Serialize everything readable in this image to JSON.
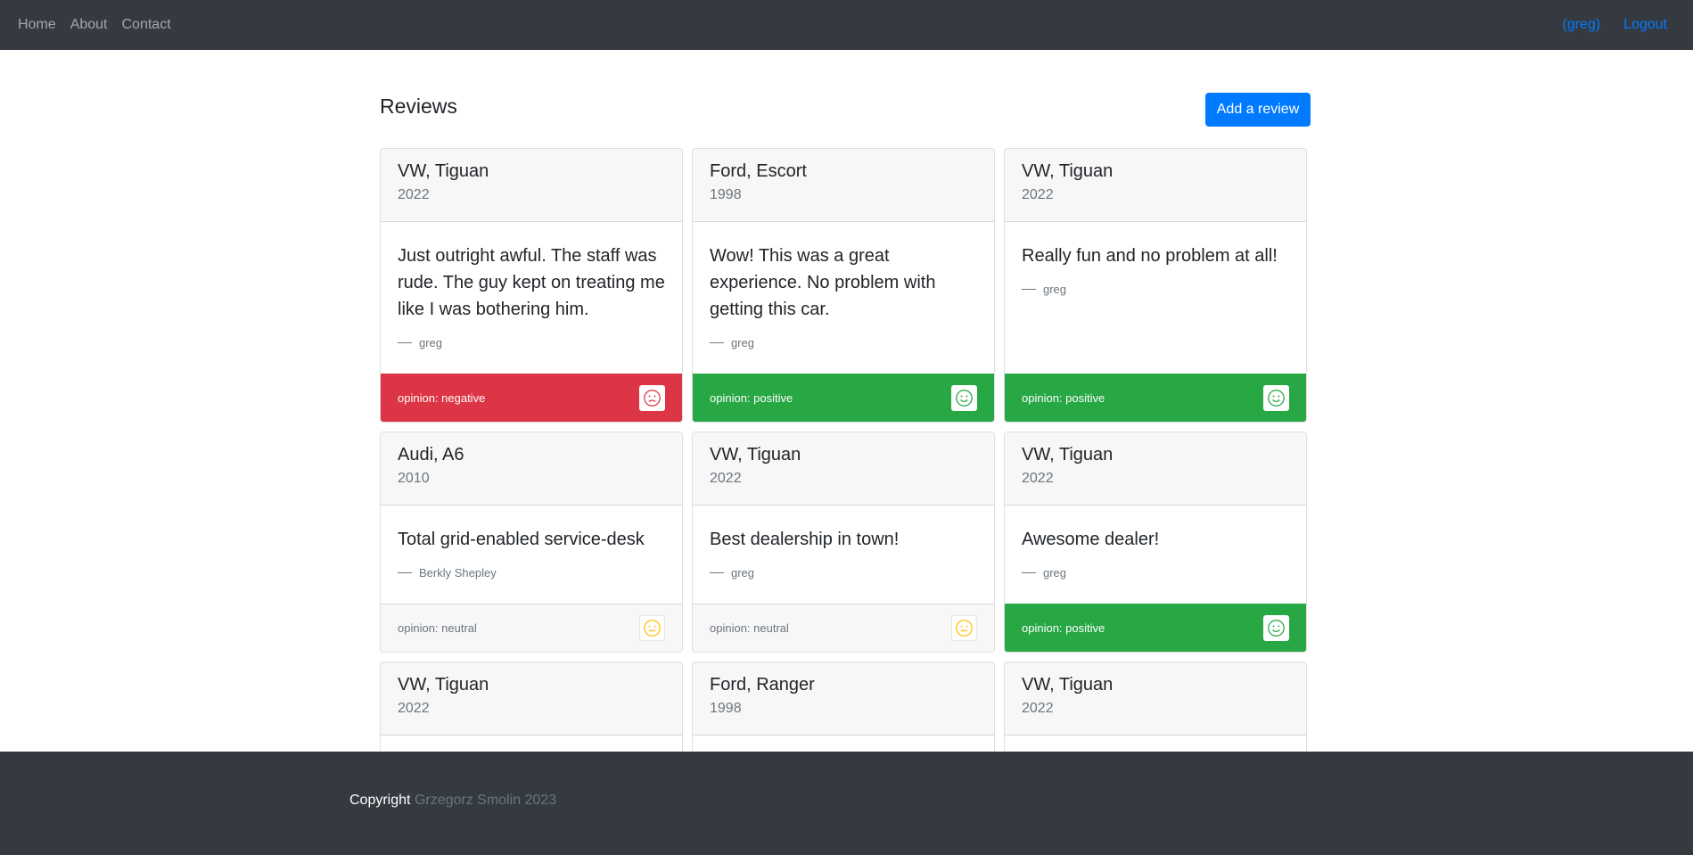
{
  "nav": {
    "links": [
      "Home",
      "About",
      "Contact"
    ],
    "user": "(greg)",
    "logout": "Logout"
  },
  "page": {
    "title": "Reviews",
    "add_button": "Add a review"
  },
  "reviews": [
    {
      "title": "VW, Tiguan",
      "year": "2022",
      "text": "Just outright awful. The staff was rude. The guy kept on treating me like I was bothering him.",
      "author": "greg",
      "opinion": "opinion: negative",
      "sentiment": "negative",
      "icon": "frown-icon"
    },
    {
      "title": "Ford, Escort",
      "year": "1998",
      "text": "Wow! This was a great experience. No problem with getting this car.",
      "author": "greg",
      "opinion": "opinion: positive",
      "sentiment": "positive",
      "icon": "smile-icon"
    },
    {
      "title": "VW, Tiguan",
      "year": "2022",
      "text": "Really fun and no problem at all!",
      "author": "greg",
      "opinion": "opinion: positive",
      "sentiment": "positive",
      "icon": "smile-icon"
    },
    {
      "title": "Audi, A6",
      "year": "2010",
      "text": "Total grid-enabled service-desk",
      "author": "Berkly Shepley",
      "opinion": "opinion: neutral",
      "sentiment": "neutral",
      "icon": "neutral-face-icon"
    },
    {
      "title": "VW, Tiguan",
      "year": "2022",
      "text": "Best dealership in town!",
      "author": "greg",
      "opinion": "opinion: neutral",
      "sentiment": "neutral",
      "icon": "neutral-face-icon"
    },
    {
      "title": "VW, Tiguan",
      "year": "2022",
      "text": "Awesome dealer!",
      "author": "greg",
      "opinion": "opinion: positive",
      "sentiment": "positive",
      "icon": "smile-icon"
    },
    {
      "title": "VW, Tiguan",
      "year": "2022"
    },
    {
      "title": "Ford, Ranger",
      "year": "1998"
    },
    {
      "title": "VW, Tiguan",
      "year": "2022"
    }
  ],
  "colors": {
    "negative": "#dc3545",
    "positive": "#28a745",
    "neutral": "#ffc107",
    "primary": "#007bff",
    "dark": "#343a40"
  },
  "footer": {
    "label": "Copyright",
    "owner": "Grzegorz Smolin 2023"
  }
}
